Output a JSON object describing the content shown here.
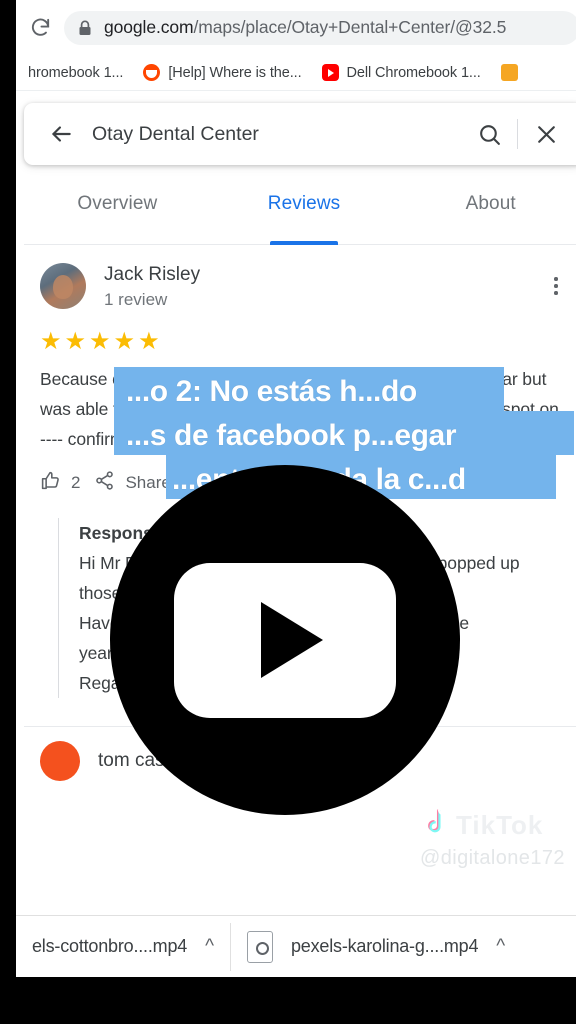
{
  "browser": {
    "reload_icon": "reload-icon",
    "lock_icon": "lock-icon",
    "url_host": "google.com",
    "url_path": "/maps/place/Otay+Dental+Center/@32.5",
    "bookmarks": [
      {
        "label": "hromebook 1...",
        "favicon": "generic-favicon"
      },
      {
        "label": "[Help] Where is the...",
        "favicon": "reddit-favicon"
      },
      {
        "label": "Dell Chromebook 1...",
        "favicon": "youtube-favicon"
      },
      {
        "label": "",
        "favicon": "amber-favicon"
      }
    ]
  },
  "maps": {
    "back_icon": "back-arrow-icon",
    "place_title": "Otay Dental Center",
    "search_icon": "search-icon",
    "close_icon": "close-icon",
    "tabs": [
      {
        "label": "Overview",
        "active": false
      },
      {
        "label": "Reviews",
        "active": true
      },
      {
        "label": "About",
        "active": false
      }
    ],
    "review": {
      "avatar": "reviewer-avatar",
      "name": "Jack Risley",
      "review_count": "1 review",
      "menu_icon": "kebab-menu-icon",
      "rating": 5,
      "star_glyph": "★",
      "text": "Because of COVID I'd been unable to see Dr Termin for a year but was able to have a  phone consultation  and his analysis was spot on ---- confirmed by",
      "like_icon": "thumbs-up-icon",
      "like_count": "2",
      "share_icon": "share-icon",
      "share_label": "Share",
      "response": {
        "title": "Response from the owner",
        "lines": [
          "Hi Mr Risley. I remember your surprise when iI popped up",
          "those X- rays on the TV.",
          "Have enjoyed our continued  dental history over the",
          "years.  Always a pleasure to see you!!",
          "Regards."
        ]
      }
    },
    "next_review": {
      "avatar": "next-reviewer-avatar",
      "name": "tom cassioli"
    }
  },
  "caption": {
    "lines": [
      "...o 2: No estás h...do",
      "...s de facebook p...egar",
      "...ente de toda la c...d"
    ],
    "highlight_color": "#74b4ec",
    "text_color": "#ffffff"
  },
  "play_overlay": {
    "icon": "youtube-play-icon",
    "label": "play"
  },
  "watermark": {
    "logo_icon": "tiktok-logo-icon",
    "word": "TikTok",
    "handle": "@digitalone172"
  },
  "downloads": [
    {
      "name": "els-cottonbro....mp4",
      "caret": "^",
      "has_icon": false
    },
    {
      "name": "pexels-karolina-g....mp4",
      "caret": "^",
      "has_icon": true,
      "file_icon": "video-file-icon"
    }
  ]
}
